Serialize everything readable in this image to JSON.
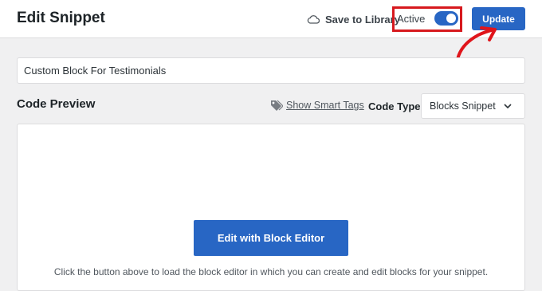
{
  "header": {
    "title": "Edit Snippet",
    "save_to_library": "Save to Library",
    "active_label": "Active",
    "active_on": true,
    "update_label": "Update"
  },
  "snippet": {
    "title_value": "Custom Block For Testimonials"
  },
  "code_preview": {
    "heading": "Code Preview",
    "smart_tags_label": "Show Smart Tags",
    "code_type_label": "Code Type",
    "code_type_value": "Blocks Snippet"
  },
  "editor": {
    "button_label": "Edit with Block Editor",
    "help_text": "Click the button above to load the block editor in which you can create and edit blocks for your snippet."
  },
  "colors": {
    "accent": "#2866c4",
    "highlight": "#d7191e"
  },
  "icons": {
    "save": "cloud-icon",
    "smart_tags": "tag-icon",
    "select": "chevron-down-icon"
  }
}
